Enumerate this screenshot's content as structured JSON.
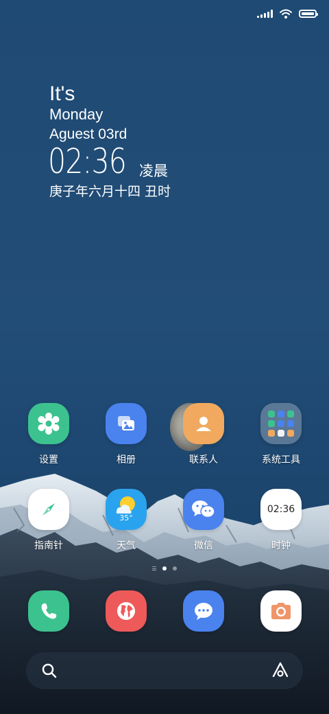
{
  "status_bar": {
    "signal_icon": "signal-icon",
    "wifi_icon": "wifi-icon",
    "battery_icon": "battery-icon"
  },
  "widget": {
    "line1": "It's",
    "line2": "Monday",
    "line3": "Aguest 03rd",
    "time": "02:36",
    "period": "凌晨",
    "lunar": "庚子年六月十四 丑时"
  },
  "apps_row1": [
    {
      "label": "设置",
      "icon": "gear-icon",
      "color": "#3cc28f"
    },
    {
      "label": "相册",
      "icon": "gallery-icon",
      "color": "#4a82ee"
    },
    {
      "label": "联系人",
      "icon": "contact-icon",
      "color": "#f0a95e"
    },
    {
      "label": "系统工具",
      "icon": "folder-icon",
      "color": "#6c7d90"
    }
  ],
  "apps_row2": [
    {
      "label": "指南针",
      "icon": "compass-icon",
      "color": "#ffffff"
    },
    {
      "label": "天气",
      "icon": "weather-icon",
      "temp": "35°",
      "color": "#2aa3ef"
    },
    {
      "label": "微信",
      "icon": "wechat-icon",
      "color": "#4a82ee"
    },
    {
      "label": "时钟",
      "icon": "clock-icon",
      "time": "02:36",
      "color": "#ffffff"
    }
  ],
  "dock": [
    {
      "name": "phone",
      "icon": "phone-icon",
      "color": "#3cc28f"
    },
    {
      "name": "browser",
      "icon": "globe-icon",
      "color": "#ee5a5a"
    },
    {
      "name": "messages",
      "icon": "message-icon",
      "color": "#4a82ee"
    },
    {
      "name": "camera",
      "icon": "camera-icon",
      "color": "#ffffff"
    }
  ],
  "search_bar": {
    "search_icon": "search-icon",
    "assistant_icon": "assistant-icon"
  },
  "page_indicator": {
    "pages": 2,
    "active": 1
  }
}
